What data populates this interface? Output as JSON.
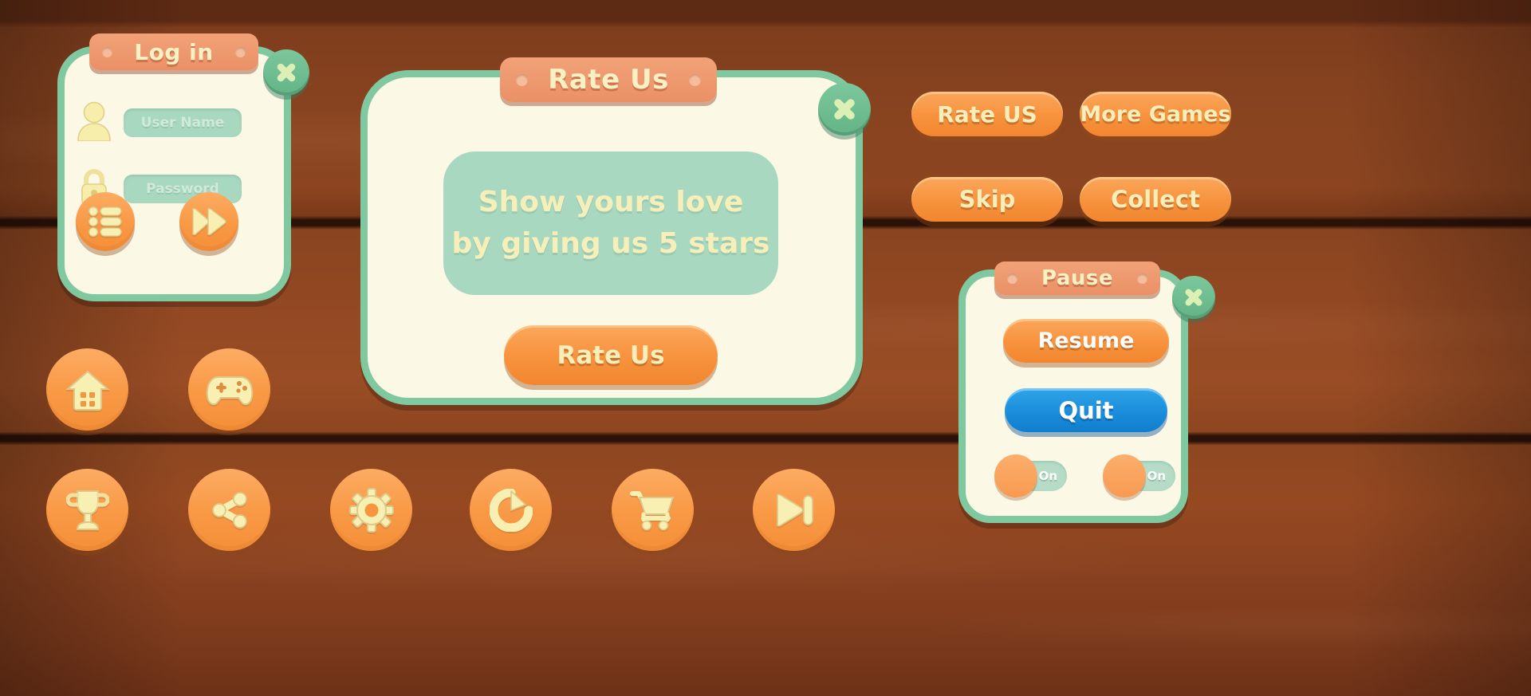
{
  "theme": {
    "wood_dark": "#5d2a13",
    "wood_mid": "#8c4520",
    "panel_cream": "#fbf8e6",
    "mint_border": "#7fc8a0",
    "mint_fill": "#a9d8c0",
    "orange": "#f7923d",
    "orange_light": "#fcac63",
    "plate_orange": "#ea9066",
    "blue": "#1b8ddb",
    "text_cream": "#f9edb9"
  },
  "login_panel": {
    "title": "Log in",
    "close_icon": "close-icon",
    "username": {
      "icon": "user-icon",
      "placeholder": "User Name",
      "value": ""
    },
    "password": {
      "icon": "lock-icon",
      "placeholder": "Password",
      "value": ""
    },
    "buttons": [
      {
        "name": "list-button",
        "icon": "list-icon"
      },
      {
        "name": "play-forward-button",
        "icon": "fast-forward-icon"
      }
    ]
  },
  "rate_dialog": {
    "title": "Rate Us",
    "close_icon": "close-icon",
    "message_line_1": "Show yours love",
    "message_line_2": "by giving us 5 stars",
    "cta_label": "Rate Us"
  },
  "action_buttons": [
    {
      "id": "rate-us",
      "label": "Rate US"
    },
    {
      "id": "more-games",
      "label": "More Games"
    },
    {
      "id": "skip",
      "label": "Skip"
    },
    {
      "id": "collect",
      "label": "Collect"
    }
  ],
  "pause_panel": {
    "title": "Pause",
    "close_icon": "close-icon",
    "resume_label": "Resume",
    "quit_label": "Quit",
    "toggles": [
      {
        "id": "toggle-music",
        "state_label": "On"
      },
      {
        "id": "toggle-sound",
        "state_label": "On"
      }
    ]
  },
  "icon_buttons": [
    {
      "id": "home",
      "icon": "home-icon"
    },
    {
      "id": "game",
      "icon": "gamepad-icon"
    },
    {
      "id": "trophy",
      "icon": "trophy-icon"
    },
    {
      "id": "share",
      "icon": "share-icon"
    },
    {
      "id": "gear",
      "icon": "gear-icon"
    },
    {
      "id": "restart",
      "icon": "restart-icon"
    },
    {
      "id": "cart",
      "icon": "shopping-cart-icon"
    },
    {
      "id": "next",
      "icon": "skip-forward-icon"
    }
  ]
}
